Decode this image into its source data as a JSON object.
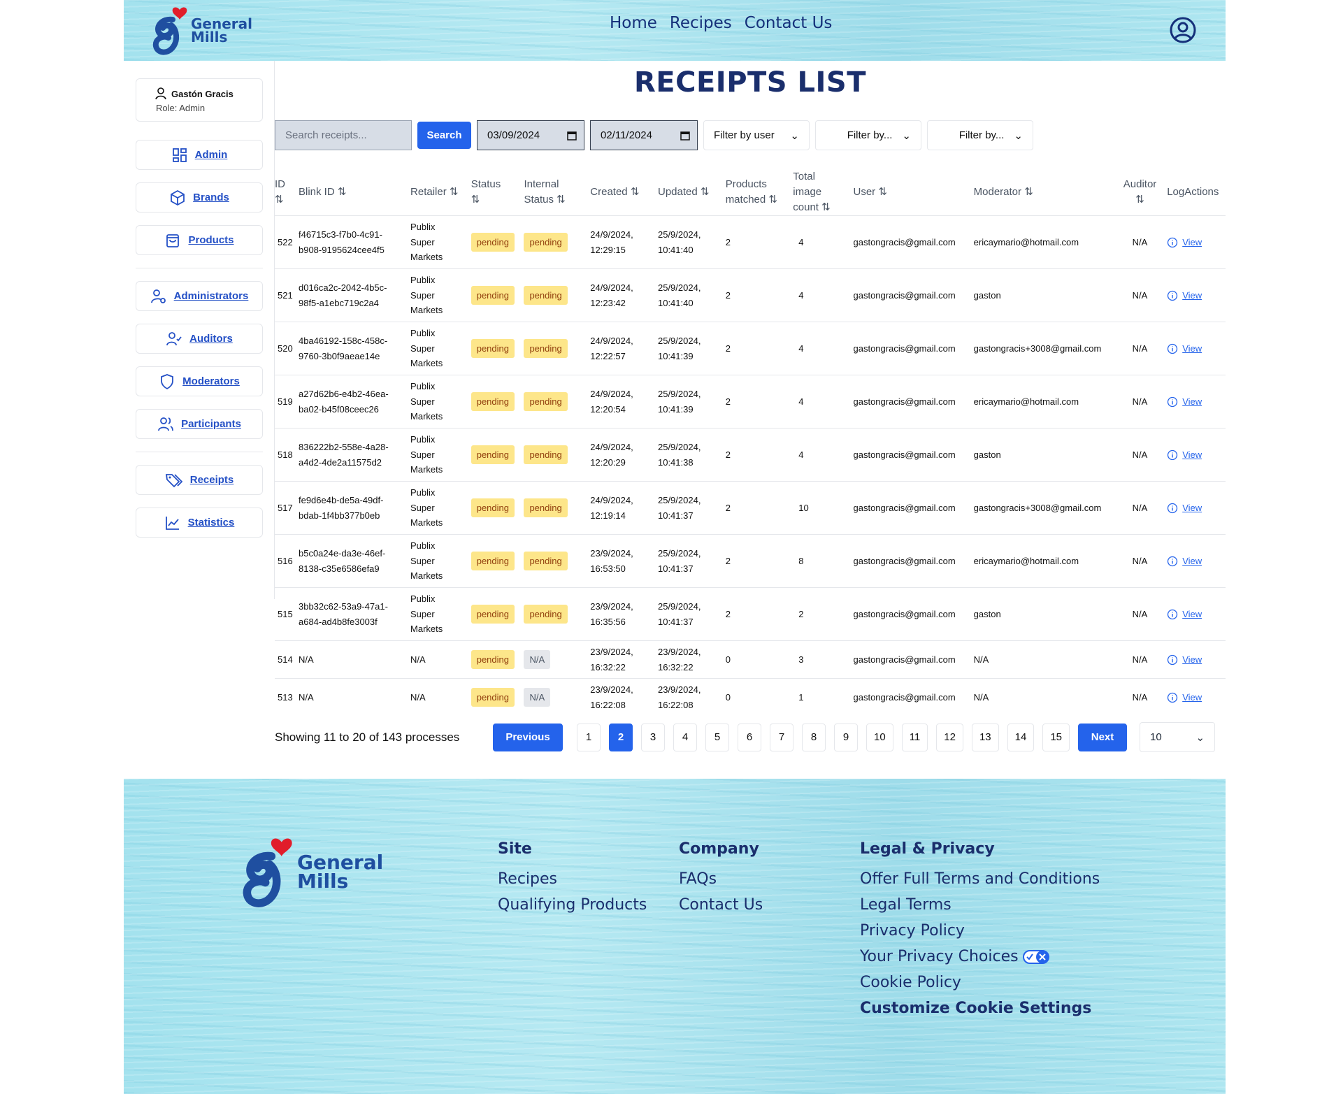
{
  "brand": {
    "line1": "General",
    "line2": "Mills"
  },
  "nav": [
    "Home",
    "Recipes",
    "Contact Us"
  ],
  "user": {
    "name": "Gastón Gracis",
    "role": "Role: Admin"
  },
  "sidebar": [
    "Admin",
    "Brands",
    "Products",
    "Administrators",
    "Auditors",
    "Moderators",
    "Participants",
    "Receipts",
    "Statistics"
  ],
  "page_title": "RECEIPTS LIST",
  "filters": {
    "search_placeholder": "Search receipts...",
    "search_button": "Search",
    "date_from": "03/09/2024",
    "date_to": "02/11/2024",
    "filter_user": "Filter by user",
    "filter_2": "Filter by...",
    "filter_3": "Filter by..."
  },
  "table": {
    "headers": {
      "id": "ID",
      "blink": "Blink ID",
      "retailer": "Retailer",
      "status": "Status",
      "internal1": "Internal",
      "internal2": "Status",
      "created": "Created",
      "updated": "Updated",
      "products1": "Products",
      "products2": "matched",
      "total1": "Total",
      "total2": "image",
      "total3": "count",
      "user": "User",
      "moderator": "Moderator",
      "auditor": "Auditor",
      "log": "LogActions"
    },
    "rows": [
      {
        "id": "522",
        "blink1": "f46715c3-f7b0-4c91-",
        "blink2": "b908-9195624cee4f5",
        "retailer": [
          "Publix",
          "Super",
          "Markets"
        ],
        "status": "pending",
        "internal": "pending",
        "created1": "24/9/2024,",
        "created2": "12:29:15",
        "updated1": "25/9/2024,",
        "updated2": "10:41:40",
        "products": "2",
        "images": "4",
        "user": "gastongracis@gmail.com",
        "moderator": "ericaymario@hotmail.com",
        "auditor": "N/A",
        "action": "View"
      },
      {
        "id": "521",
        "blink1": "d016ca2c-2042-4b5c-",
        "blink2": "98f5-a1ebc719c2a4",
        "retailer": [
          "Publix",
          "Super",
          "Markets"
        ],
        "status": "pending",
        "internal": "pending",
        "created1": "24/9/2024,",
        "created2": "12:23:42",
        "updated1": "25/9/2024,",
        "updated2": "10:41:40",
        "products": "2",
        "images": "4",
        "user": "gastongracis@gmail.com",
        "moderator": "gaston",
        "auditor": "N/A",
        "action": "View"
      },
      {
        "id": "520",
        "blink1": "4ba46192-158c-458c-",
        "blink2": "9760-3b0f9aeae14e",
        "retailer": [
          "Publix",
          "Super",
          "Markets"
        ],
        "status": "pending",
        "internal": "pending",
        "created1": "24/9/2024,",
        "created2": "12:22:57",
        "updated1": "25/9/2024,",
        "updated2": "10:41:39",
        "products": "2",
        "images": "4",
        "user": "gastongracis@gmail.com",
        "moderator": "gastongracis+3008@gmail.com",
        "auditor": "N/A",
        "action": "View"
      },
      {
        "id": "519",
        "blink1": "a27d62b6-e4b2-46ea-",
        "blink2": "ba02-b45f08ceec26",
        "retailer": [
          "Publix",
          "Super",
          "Markets"
        ],
        "status": "pending",
        "internal": "pending",
        "created1": "24/9/2024,",
        "created2": "12:20:54",
        "updated1": "25/9/2024,",
        "updated2": "10:41:39",
        "products": "2",
        "images": "4",
        "user": "gastongracis@gmail.com",
        "moderator": "ericaymario@hotmail.com",
        "auditor": "N/A",
        "action": "View"
      },
      {
        "id": "518",
        "blink1": "836222b2-558e-4a28-",
        "blink2": "a4d2-4de2a11575d2",
        "retailer": [
          "Publix",
          "Super",
          "Markets"
        ],
        "status": "pending",
        "internal": "pending",
        "created1": "24/9/2024,",
        "created2": "12:20:29",
        "updated1": "25/9/2024,",
        "updated2": "10:41:38",
        "products": "2",
        "images": "4",
        "user": "gastongracis@gmail.com",
        "moderator": "gaston",
        "auditor": "N/A",
        "action": "View"
      },
      {
        "id": "517",
        "blink1": "fe9d6e4b-de5a-49df-",
        "blink2": "bdab-1f4bb377b0eb",
        "retailer": [
          "Publix",
          "Super",
          "Markets"
        ],
        "status": "pending",
        "internal": "pending",
        "created1": "24/9/2024,",
        "created2": "12:19:14",
        "updated1": "25/9/2024,",
        "updated2": "10:41:37",
        "products": "2",
        "images": "10",
        "user": "gastongracis@gmail.com",
        "moderator": "gastongracis+3008@gmail.com",
        "auditor": "N/A",
        "action": "View"
      },
      {
        "id": "516",
        "blink1": "b5c0a24e-da3e-46ef-",
        "blink2": "8138-c35e6586efa9",
        "retailer": [
          "Publix",
          "Super",
          "Markets"
        ],
        "status": "pending",
        "internal": "pending",
        "created1": "23/9/2024,",
        "created2": "16:53:50",
        "updated1": "25/9/2024,",
        "updated2": "10:41:37",
        "products": "2",
        "images": "8",
        "user": "gastongracis@gmail.com",
        "moderator": "ericaymario@hotmail.com",
        "auditor": "N/A",
        "action": "View"
      },
      {
        "id": "515",
        "blink1": "3bb32c62-53a9-47a1-",
        "blink2": "a684-ad4b8fe3003f",
        "retailer": [
          "Publix",
          "Super",
          "Markets"
        ],
        "status": "pending",
        "internal": "pending",
        "created1": "23/9/2024,",
        "created2": "16:35:56",
        "updated1": "25/9/2024,",
        "updated2": "10:41:37",
        "products": "2",
        "images": "2",
        "user": "gastongracis@gmail.com",
        "moderator": "gaston",
        "auditor": "N/A",
        "action": "View"
      },
      {
        "id": "514",
        "blink1": "N/A",
        "blink2": "",
        "retailer": [
          "N/A"
        ],
        "status": "pending",
        "internal": "N/A",
        "created1": "23/9/2024,",
        "created2": "16:32:22",
        "updated1": "23/9/2024,",
        "updated2": "16:32:22",
        "products": "0",
        "images": "3",
        "user": "gastongracis@gmail.com",
        "moderator": "N/A",
        "auditor": "N/A",
        "action": "View"
      },
      {
        "id": "513",
        "blink1": "N/A",
        "blink2": "",
        "retailer": [
          "N/A"
        ],
        "status": "pending",
        "internal": "N/A",
        "created1": "23/9/2024,",
        "created2": "16:22:08",
        "updated1": "23/9/2024,",
        "updated2": "16:22:08",
        "products": "0",
        "images": "1",
        "user": "gastongracis@gmail.com",
        "moderator": "N/A",
        "auditor": "N/A",
        "action": "View"
      }
    ]
  },
  "pagination": {
    "showing": "Showing 11 to 20 of 143 processes",
    "previous": "Previous",
    "next": "Next",
    "pages": [
      "1",
      "2",
      "3",
      "4",
      "5",
      "6",
      "7",
      "8",
      "9",
      "10",
      "11",
      "12",
      "13",
      "14",
      "15"
    ],
    "current": "2",
    "page_size": "10"
  },
  "footer": {
    "site": {
      "title": "Site",
      "links": [
        "Recipes",
        "Qualifying Products"
      ]
    },
    "company": {
      "title": "Company",
      "links": [
        "FAQs",
        "Contact Us"
      ]
    },
    "legal": {
      "title": "Legal & Privacy",
      "links": [
        "Offer Full Terms and Conditions",
        "Legal Terms",
        "Privacy Policy",
        "Your Privacy Choices",
        "Cookie Policy"
      ],
      "bold_link": "Customize Cookie Settings"
    }
  },
  "colors": {
    "primary": "#2463eb",
    "navy": "#1a2e6c",
    "badge": "#fde68a",
    "water": "#9ee0ec"
  },
  "icons": {
    "user": "person-icon",
    "admin": "grid-icon",
    "brands": "cube-icon",
    "products": "bag-icon",
    "administrators": "user-gear-icon",
    "auditors": "user-check-icon",
    "moderators": "shield-icon",
    "participants": "users-icon",
    "receipts": "tag-icon",
    "statistics": "chart-icon"
  }
}
